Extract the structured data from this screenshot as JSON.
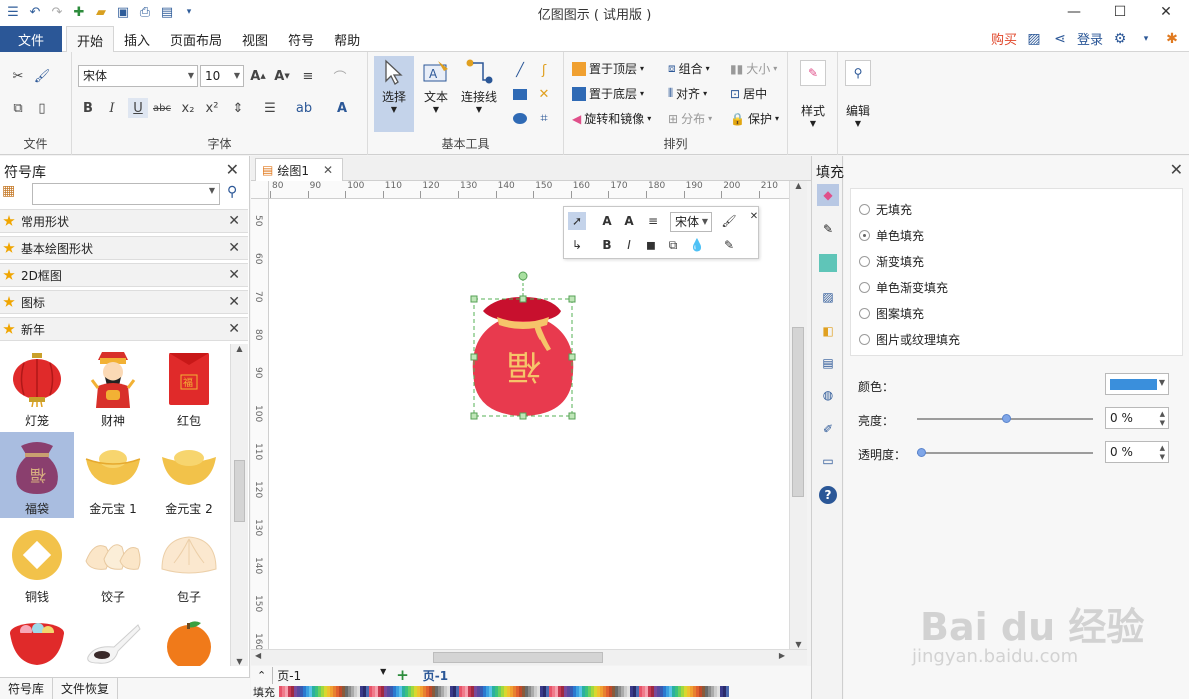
{
  "titlebar": {
    "title": "亿图图示 ( 试用版 )",
    "minimize": "—",
    "maximize": "☐",
    "close": "✕"
  },
  "menu": {
    "file": "文件",
    "tabs": [
      "开始",
      "插入",
      "页面布局",
      "视图",
      "符号",
      "帮助"
    ],
    "buy": "购买",
    "login": "登录"
  },
  "ribbon": {
    "groups": {
      "file": "文件",
      "font": "字体",
      "basic_tools": "基本工具",
      "arrange": "排列"
    },
    "font_name": "宋体",
    "font_size": "10",
    "tools": {
      "select": "选择",
      "text": "文本",
      "connector": "连接线"
    },
    "arrange": {
      "bring_front": "置于顶层",
      "send_back": "置于底层",
      "rotate": "旋转和镜像",
      "group": "组合",
      "align": "对齐",
      "distribute": "分布",
      "size": "大小",
      "center": "居中",
      "protect": "保护"
    },
    "style": "样式",
    "edit": "编辑"
  },
  "library": {
    "title": "符号库",
    "categories": [
      "常用形状",
      "基本绘图形状",
      "2D框图",
      "图标",
      "新年"
    ],
    "shapes": [
      "灯笼",
      "财神",
      "红包",
      "福袋",
      "金元宝 1",
      "金元宝 2",
      "铜钱",
      "饺子",
      "包子"
    ],
    "bottom_tabs": [
      "符号库",
      "文件恢复"
    ]
  },
  "document": {
    "tab": "绘图1",
    "ruler_h": [
      "80",
      "90",
      "100",
      "110",
      "120",
      "130",
      "140",
      "150",
      "160",
      "170",
      "180",
      "190",
      "200",
      "210"
    ],
    "ruler_v": [
      "50",
      "60",
      "70",
      "80",
      "90",
      "100",
      "110",
      "120",
      "130",
      "140",
      "150",
      "160"
    ],
    "mini_font": "宋体",
    "fu_char": "福",
    "page_select": "页-1",
    "page_tab": "页-1",
    "fill_label": "填充"
  },
  "fill_panel": {
    "title": "填充",
    "options": [
      "无填充",
      "单色填充",
      "渐变填充",
      "单色渐变填充",
      "图案填充",
      "图片或纹理填充"
    ],
    "selected_index": 1,
    "color_label": "颜色：",
    "brightness_label": "亮度：",
    "transparency_label": "透明度：",
    "brightness_value": "0 %",
    "transparency_value": "0 %",
    "color": "#3a8fdc"
  },
  "watermark": {
    "brand": "Bai du 经验",
    "url": "jingyan.baidu.com"
  }
}
